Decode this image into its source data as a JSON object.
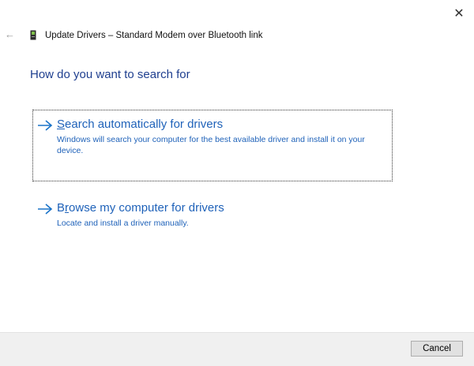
{
  "window": {
    "title": "Update Drivers – Standard Modem over Bluetooth link",
    "close_icon": "close-icon",
    "back_icon": "back-arrow-icon"
  },
  "heading": "How do you want to search for",
  "options": [
    {
      "title_accel": "S",
      "title_rest": "earch automatically for drivers",
      "description": "Windows will search your computer for the best available driver and install it on your device.",
      "icon": "arrow-right-icon"
    },
    {
      "title_pre": "B",
      "title_accel": "r",
      "title_rest": "owse my computer for drivers",
      "description": "Locate and install a driver manually.",
      "icon": "arrow-right-icon"
    }
  ],
  "footer": {
    "cancel_label": "Cancel"
  },
  "colors": {
    "link": "#1f62b9",
    "heading": "#1f3f8f",
    "footer_bg": "#f0f0f0"
  }
}
